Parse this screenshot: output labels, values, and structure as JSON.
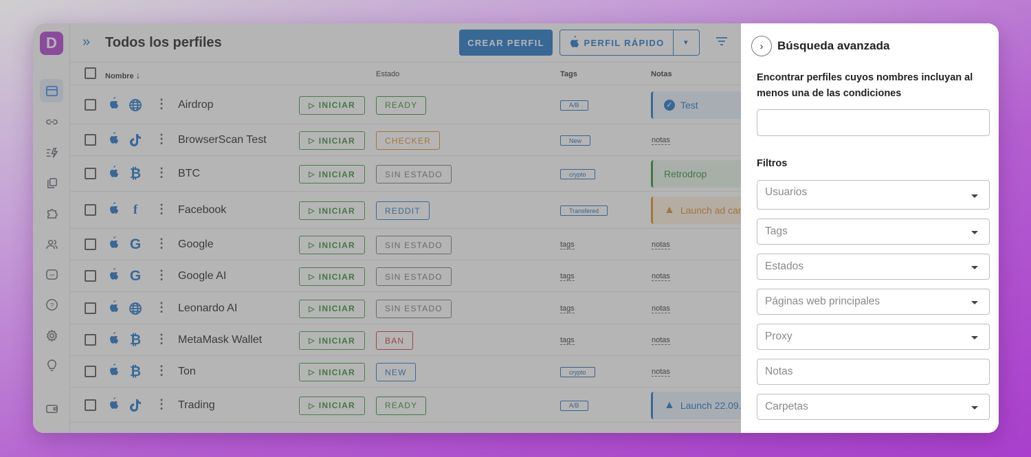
{
  "app": {
    "logo_letter": "D",
    "accent": "#1b73c6",
    "brand": "#b23fd1"
  },
  "sidebar": {
    "items": [
      {
        "name": "profiles",
        "icon": "browser-window-icon",
        "active": true
      },
      {
        "name": "proxies",
        "icon": "link-icon"
      },
      {
        "name": "automation",
        "icon": "bolt-list-icon"
      },
      {
        "name": "copy",
        "icon": "copy-icon"
      },
      {
        "name": "extensions",
        "icon": "puzzle-icon"
      },
      {
        "name": "team",
        "icon": "users-icon"
      },
      {
        "name": "api",
        "icon": "api-icon",
        "text": "API"
      },
      {
        "name": "help",
        "icon": "help-icon",
        "text": "?"
      },
      {
        "name": "settings",
        "icon": "gear-icon"
      },
      {
        "name": "ideas",
        "icon": "lightbulb-icon"
      },
      {
        "name": "wallet",
        "icon": "wallet-icon"
      }
    ]
  },
  "header": {
    "title": "Todos los perfiles",
    "create_label": "CREAR PERFIL",
    "quick_label": "PERFIL RÁPIDO"
  },
  "table": {
    "columns": {
      "name": "Nombre",
      "status": "Estado",
      "tags": "Tags",
      "notes": "Notas"
    },
    "start_label": "INICIAR",
    "rows": [
      {
        "name": "Airdrop",
        "site": "globe-icon",
        "status": "READY",
        "status_color": "#2f8f2f",
        "tag": "A/B",
        "note": {
          "text": "Test",
          "kind": "check",
          "color": "#1e73c8",
          "bg": "#e6f0fb"
        }
      },
      {
        "name": "BrowserScan Test",
        "site": "tiktok-icon",
        "status": "CHECKER",
        "status_color": "#e08a1e",
        "tag": "New",
        "notes_placeholder": "notas"
      },
      {
        "name": "BTC",
        "site": "bitcoin-icon",
        "status": "SIN ESTADO",
        "status_color": "#777777",
        "tag": "crypto",
        "note": {
          "text": "Retrodrop",
          "kind": "plain",
          "color": "#2f8f2f",
          "bg": "#e7f4e7"
        }
      },
      {
        "name": "Facebook",
        "site": "facebook-icon",
        "status": "REDDIT",
        "status_color": "#1e73c8",
        "tag": "Transfered",
        "note": {
          "text": "Launch ad cam",
          "kind": "warn",
          "color": "#e08a1e",
          "bg": "#fdf0e0"
        }
      },
      {
        "name": "Google",
        "site": "google-icon",
        "status": "SIN ESTADO",
        "status_color": "#777777",
        "tags_placeholder": "tags",
        "notes_placeholder": "notas"
      },
      {
        "name": "Google AI",
        "site": "google-icon",
        "status": "SIN ESTADO",
        "status_color": "#777777",
        "tags_placeholder": "tags",
        "notes_placeholder": "notas"
      },
      {
        "name": "Leonardo AI",
        "site": "globe-icon",
        "status": "SIN ESTADO",
        "status_color": "#777777",
        "tags_placeholder": "tags",
        "notes_placeholder": "notas"
      },
      {
        "name": "MetaMask Wallet",
        "site": "bitcoin-icon",
        "status": "BAN",
        "status_color": "#d93030",
        "tags_placeholder": "tags",
        "notes_placeholder": "notas"
      },
      {
        "name": "Ton",
        "site": "bitcoin-icon",
        "status": "NEW",
        "status_color": "#1e73c8",
        "tag": "crypto",
        "notes_placeholder": "notas"
      },
      {
        "name": "Trading",
        "site": "tiktok-icon",
        "status": "READY",
        "status_color": "#2f8f2f",
        "tag": "A/B",
        "note": {
          "text": "Launch 22.09.",
          "kind": "warn",
          "color": "#1e73c8",
          "bg": "#e6f0fb"
        }
      }
    ]
  },
  "panel": {
    "title": "Búsqueda avanzada",
    "description": "Encontrar perfiles cuyos nombres incluyan al menos una de las condiciones",
    "filters_title": "Filtros",
    "fields": [
      {
        "label": "Usuarios",
        "dropdown": true
      },
      {
        "label": "Tags",
        "dropdown": true
      },
      {
        "label": "Estados",
        "dropdown": true
      },
      {
        "label": "Páginas web principales",
        "dropdown": true
      },
      {
        "label": "Proxy",
        "dropdown": true
      },
      {
        "label": "Notas",
        "dropdown": false
      },
      {
        "label": "Carpetas",
        "dropdown": true
      }
    ]
  }
}
